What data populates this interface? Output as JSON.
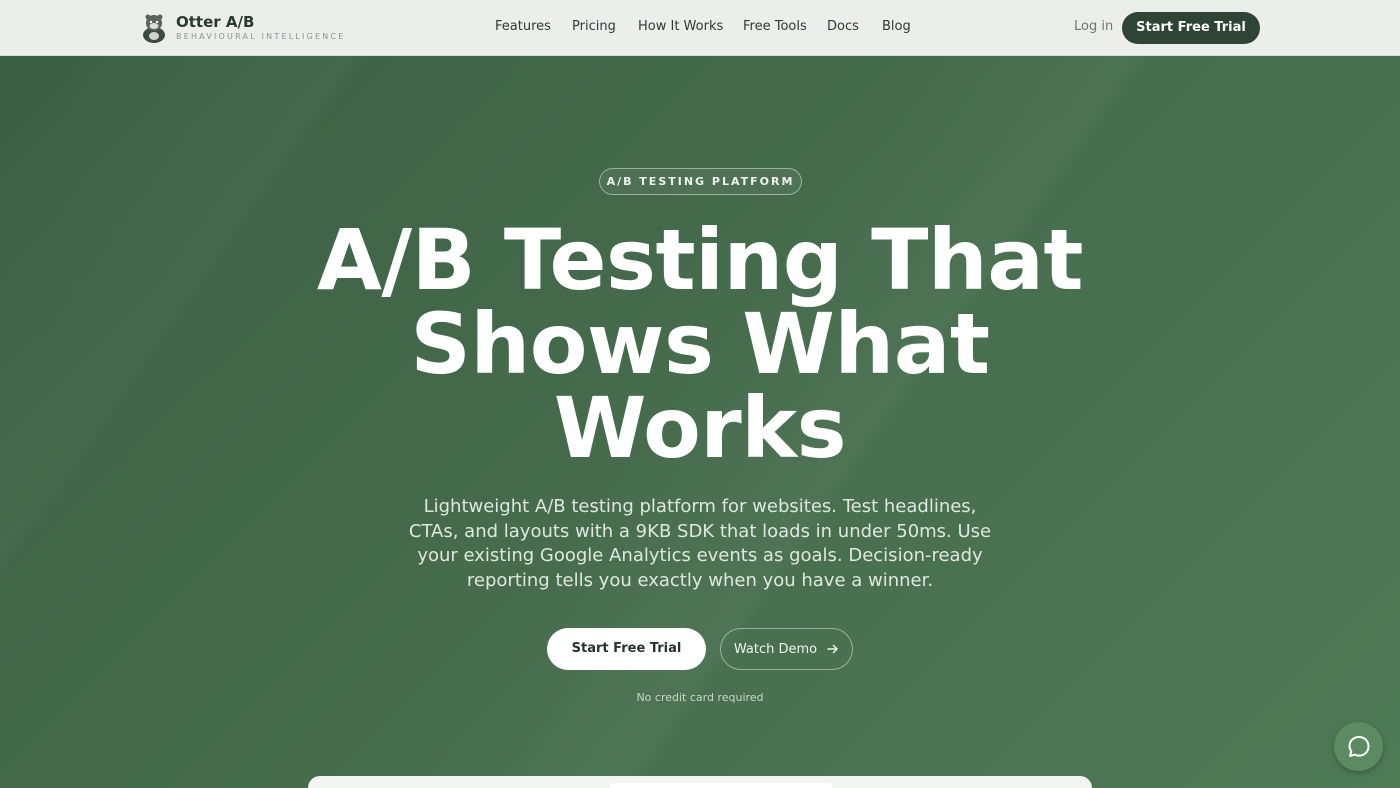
{
  "brand": {
    "name": "Otter A/B",
    "tagline": "BEHAVIOURAL INTELLIGENCE"
  },
  "nav": {
    "links": [
      "Features",
      "Pricing",
      "How It Works",
      "Free Tools",
      "Docs",
      "Blog"
    ],
    "login_label": "Log in",
    "cta_label": "Start Free Trial"
  },
  "hero": {
    "badge": "A/B TESTING PLATFORM",
    "headline_lines": [
      "A/B Testing That",
      "Shows What",
      "Works"
    ],
    "subtext": "Lightweight A/B testing platform for websites. Test headlines, CTAs, and layouts with a 9KB SDK that loads in under 50ms. Use your existing Google Analytics events as goals. Decision-ready reporting tells you exactly when you have a winner.",
    "primary_cta": "Start Free Trial",
    "secondary_cta": "Watch Demo",
    "note": "No credit card required"
  },
  "icons": {
    "logo": "otter-logo-icon",
    "arrow": "arrow-right-icon",
    "chat": "chat-bubble-icon"
  },
  "colors": {
    "nav_bg": "#eceeec",
    "hero_bg": "#42664a",
    "dark_green": "#2e4434",
    "chat_bg": "#5c8b63"
  }
}
